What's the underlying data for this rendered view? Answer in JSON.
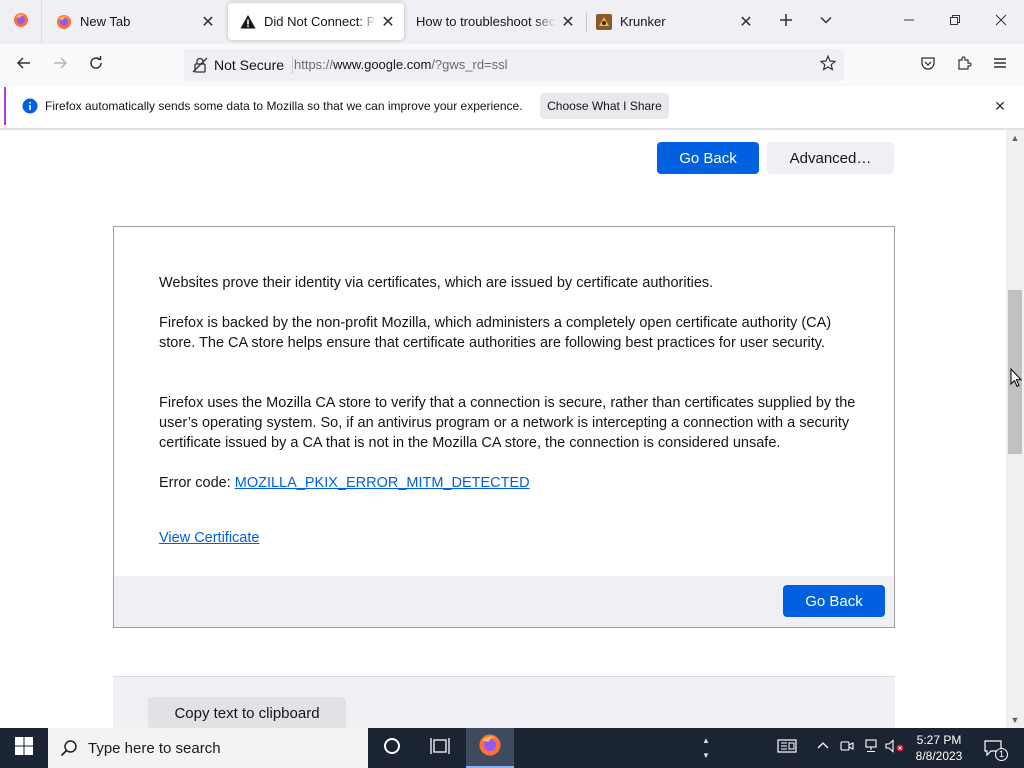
{
  "browser": {
    "tabs": [
      {
        "title": "New Tab",
        "icon": "firefox-icon"
      },
      {
        "title": "Did Not Connect: Potential Security Issue",
        "icon": "warning-icon"
      },
      {
        "title": "How to troubleshoot security error codes",
        "icon": "none"
      },
      {
        "title": "Krunker",
        "icon": "krunker-icon"
      }
    ],
    "selected_tab": 1,
    "url": {
      "identity_label": "Not Secure",
      "scheme": "https://",
      "host": "www.google.com",
      "path": "/?gws_rd=ssl"
    }
  },
  "notification": {
    "message": "Firefox automatically sends some data to Mozilla so that we can improve your experience.",
    "choose_label": "Choose What I Share",
    "accent_color": "#b833e1"
  },
  "page": {
    "go_back_label": "Go Back",
    "advanced_label": "Advanced…",
    "advanced_panel": {
      "p1": "Websites prove their identity via certificates, which are issued by certificate authorities.",
      "p2": "Firefox is backed by the non-profit Mozilla, which administers a completely open certificate authority (CA) store. The CA store helps ensure that certificate authorities are following best practices for user security.",
      "p3": "Firefox uses the Mozilla CA store to verify that a connection is secure, rather than certificates supplied by the user’s operating system. So, if an antivirus program or a network is intercepting a connection with a security certificate issued by a CA that is not in the Mozilla CA store, the connection is considered unsafe.",
      "error_code_label": "Error code: ",
      "error_code": "MOZILLA_PKIX_ERROR_MITM_DETECTED",
      "view_certificate_label": "View Certificate",
      "go_back_label": "Go Back"
    },
    "copy_label": "Copy text to clipboard",
    "primary_color": "#0061e0"
  },
  "taskbar": {
    "search_placeholder": "Type here to search",
    "time": "5:27 PM",
    "date": "8/8/2023",
    "notification_count": "1"
  }
}
